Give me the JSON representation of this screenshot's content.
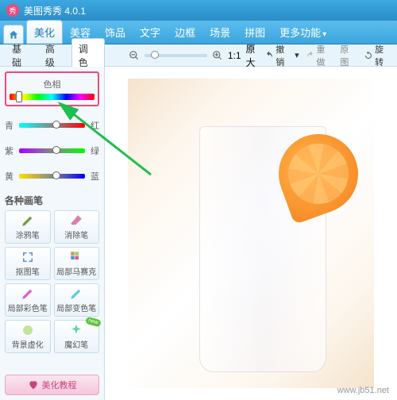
{
  "titlebar": {
    "app_name": "美图秀秀",
    "version": "4.0.1"
  },
  "menu": {
    "home_icon": "home-icon",
    "tabs": [
      "美化",
      "美容",
      "饰品",
      "文字",
      "边框",
      "场景",
      "拼图"
    ],
    "active": 0,
    "more": "更多功能",
    "more_arrow": "▾"
  },
  "subtabs": {
    "items": [
      "基础",
      "高级",
      "调色"
    ],
    "active": 2
  },
  "zoom": {
    "ratio": "1:1",
    "label": "原大"
  },
  "toolbar": {
    "undo": "撤销",
    "redo": "重做",
    "original": "原图",
    "rotate": "旋转"
  },
  "hue": {
    "title": "色相",
    "sliders": [
      {
        "left": "青",
        "right": "红"
      },
      {
        "left": "紫",
        "right": "绿"
      },
      {
        "left": "黄",
        "right": "蓝"
      }
    ]
  },
  "brushes": {
    "title": "各种画笔",
    "items": [
      {
        "label": "涂鸦笔",
        "icon": "brush-icon"
      },
      {
        "label": "消除笔",
        "icon": "eraser-icon"
      },
      {
        "label": "抠图笔",
        "icon": "cutout-icon"
      },
      {
        "label": "局部马赛克",
        "icon": "mosaic-icon"
      },
      {
        "label": "局部彩色笔",
        "icon": "color-brush-icon"
      },
      {
        "label": "局部变色笔",
        "icon": "recolor-icon"
      },
      {
        "label": "背景虚化",
        "icon": "blur-icon"
      },
      {
        "label": "魔幻笔",
        "icon": "magic-icon",
        "badge": "new"
      }
    ]
  },
  "tutorial": {
    "label": "美化教程"
  },
  "watermark": "www.jb51.net"
}
